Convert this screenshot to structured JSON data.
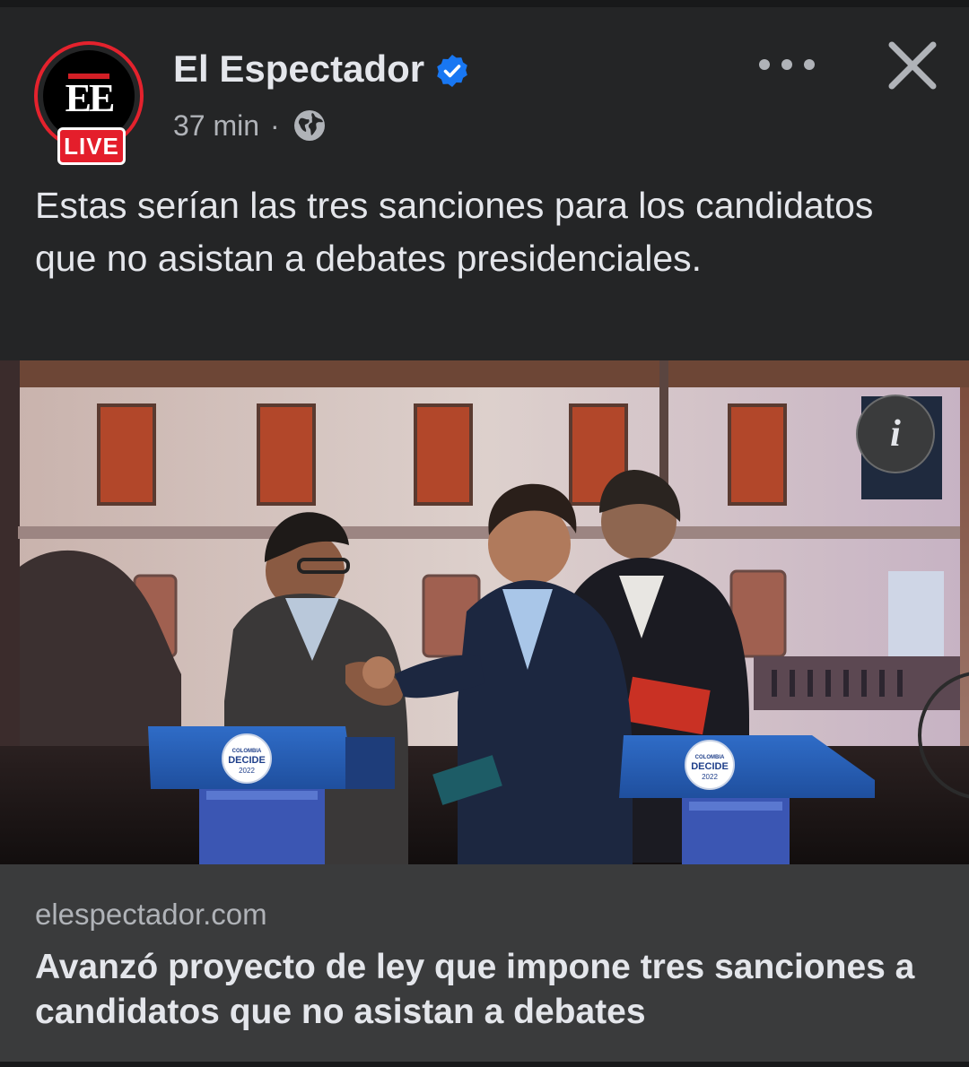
{
  "post": {
    "page_name": "El Espectador",
    "avatar_logo": "EE",
    "live_badge": "LIVE",
    "time": "37 min",
    "separator": "·",
    "audience_icon": "globe-icon",
    "verified_icon": "verified-badge-icon",
    "text": "Estas serían las tres sanciones para los candidatos que no asistan a debates presidenciales."
  },
  "photo": {
    "podium_text_top": "COLOMBIA",
    "podium_text_main": "DECIDE",
    "podium_text_year": "2022",
    "info_label": "i"
  },
  "link_preview": {
    "domain": "elespectador.com",
    "title": "Avanzó proyecto de ley que impone tres sanciones a candidatos que no asistan a debates"
  },
  "colors": {
    "background": "#242526",
    "link_box": "#3a3b3c",
    "accent_red": "#e41e2b",
    "verified_blue": "#1877f2"
  }
}
